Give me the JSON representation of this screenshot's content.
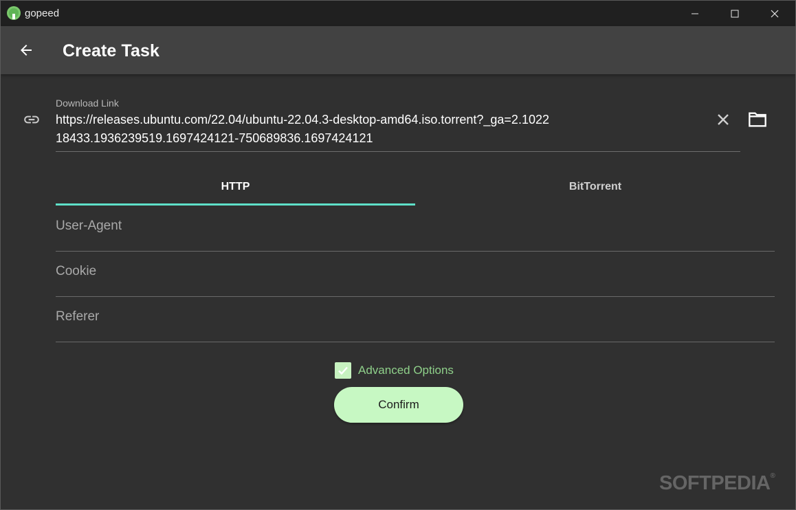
{
  "window": {
    "app_title": "gopeed",
    "controls": {
      "minimize": "minimize-icon",
      "maximize": "maximize-icon",
      "close": "close-icon"
    }
  },
  "appbar": {
    "back_icon": "arrow-left-icon",
    "title": "Create Task"
  },
  "link": {
    "icon": "link-icon",
    "label": "Download Link",
    "value": "https://releases.ubuntu.com/22.04/ubuntu-22.04.3-desktop-amd64.iso.torrent?_ga=2.102218433.1936239519.1697424121-750689836.1697424121",
    "clear_icon": "close-icon",
    "folder_icon": "folder-icon"
  },
  "tabs": [
    {
      "label": "HTTP",
      "selected": true
    },
    {
      "label": "BitTorrent",
      "selected": false
    }
  ],
  "fields": [
    {
      "placeholder": "User-Agent",
      "value": ""
    },
    {
      "placeholder": "Cookie",
      "value": ""
    },
    {
      "placeholder": "Referer",
      "value": ""
    }
  ],
  "advanced": {
    "label": "Advanced Options",
    "checked": true
  },
  "confirm": {
    "label": "Confirm"
  },
  "watermark": {
    "text": "SOFTPEDIA",
    "mark": "®"
  },
  "colors": {
    "accent": "#5ee0c8",
    "button_bg": "#c7f8c3",
    "checkbox_bg": "#c7f2c0",
    "advanced_text": "#8fd08a",
    "background": "#303030",
    "appbar": "#424242",
    "titlebar": "#202020"
  }
}
